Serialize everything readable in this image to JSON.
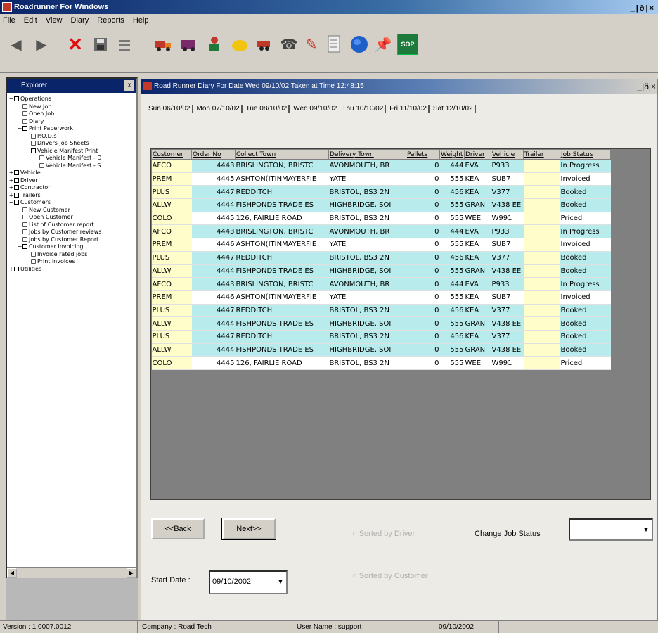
{
  "app": {
    "title": "Roadrunner For Windows",
    "window_buttons": "_|ð|×"
  },
  "menu": [
    "File",
    "Edit",
    "View",
    "Diary",
    "Reports",
    "Help"
  ],
  "toolbar": {
    "icons": [
      "back-arrow-icon",
      "forward-arrow-icon",
      "delete-icon",
      "save-icon",
      "tools-icon",
      "truck-icon",
      "vehicle-icon",
      "driver-icon",
      "helmet-icon",
      "trailer-icon",
      "phone-icon",
      "pencil-icon",
      "document-icon",
      "globe-icon",
      "pin-icon",
      "sop-icon"
    ],
    "sop_label": "SOP"
  },
  "explorer": {
    "title": "Explorer",
    "tree": [
      {
        "label": "Operations",
        "level": 0,
        "exp": "−",
        "folder": true
      },
      {
        "label": "New Job",
        "level": 1,
        "exp": "",
        "folder": false
      },
      {
        "label": "Open Job",
        "level": 1,
        "exp": "",
        "folder": false
      },
      {
        "label": "Diary",
        "level": 1,
        "exp": "",
        "folder": false
      },
      {
        "label": "Print Paperwork",
        "level": 1,
        "exp": "−",
        "folder": true
      },
      {
        "label": "P.O.D.s",
        "level": 2,
        "exp": "",
        "folder": false
      },
      {
        "label": "Drivers Job Sheets",
        "level": 2,
        "exp": "",
        "folder": false
      },
      {
        "label": "Vehicle Manifest Print",
        "level": 2,
        "exp": "−",
        "folder": true
      },
      {
        "label": "Vehicle Manifest - D",
        "level": 3,
        "exp": "",
        "folder": false
      },
      {
        "label": "Vehicle Manifest - S",
        "level": 3,
        "exp": "",
        "folder": false
      },
      {
        "label": "Vehicle",
        "level": 0,
        "exp": "+",
        "folder": true
      },
      {
        "label": "Driver",
        "level": 0,
        "exp": "+",
        "folder": true
      },
      {
        "label": "Contractor",
        "level": 0,
        "exp": "+",
        "folder": true
      },
      {
        "label": "Trailers",
        "level": 0,
        "exp": "+",
        "folder": true
      },
      {
        "label": "Customers",
        "level": 0,
        "exp": "−",
        "folder": true
      },
      {
        "label": "New Customer",
        "level": 1,
        "exp": "",
        "folder": false
      },
      {
        "label": "Open Customer",
        "level": 1,
        "exp": "",
        "folder": false
      },
      {
        "label": "List of Customer report",
        "level": 1,
        "exp": "",
        "folder": false
      },
      {
        "label": "Jobs by Customer reviews",
        "level": 1,
        "exp": "",
        "folder": false
      },
      {
        "label": "Jobs by Customer Report",
        "level": 1,
        "exp": "",
        "folder": false
      },
      {
        "label": "Customer Invoicing",
        "level": 1,
        "exp": "−",
        "folder": true
      },
      {
        "label": "Invoice rated jobs",
        "level": 2,
        "exp": "",
        "folder": false
      },
      {
        "label": "Print invoices",
        "level": 2,
        "exp": "",
        "folder": false
      },
      {
        "label": "Utilities",
        "level": 0,
        "exp": "+",
        "folder": true
      }
    ]
  },
  "diary": {
    "title": "Road Runner Diary For Date Wed 09/10/02 Taken at Time 12:48:15",
    "window_buttons": "_|ð|×",
    "days": [
      "Sun 06/10/02",
      "Mon 07/10/02",
      "Tue 08/10/02",
      "Wed 09/10/02",
      "Thu 10/10/02",
      "Fri 11/10/02",
      "Sat 12/10/02"
    ],
    "active_day": 3,
    "columns": [
      "Customer",
      "Order No",
      "Collect Town",
      "Delivery Town",
      "Pallets",
      "Weight",
      "Driver",
      "Vehicle",
      "Trailer",
      "Job Status"
    ],
    "rows": [
      {
        "tint": "c",
        "cells": [
          "AFCO",
          "4443",
          "BRISLINGTON, BRISTC",
          "AVONMOUTH, BR",
          "0",
          "444",
          "EVA",
          "P933",
          "",
          "In Progress"
        ]
      },
      {
        "tint": "w",
        "cells": [
          "PREM",
          "4445",
          "ASHTON(ITINMAYERFIE",
          "YATE",
          "0",
          "555",
          "KEA",
          "SUB7",
          "",
          "Invoiced"
        ]
      },
      {
        "tint": "c",
        "cells": [
          "PLUS",
          "4447",
          "REDDITCH",
          "BRISTOL, BS3 2N",
          "0",
          "456",
          "KEA",
          "V377",
          "",
          "Booked"
        ]
      },
      {
        "tint": "c",
        "cells": [
          "ALLW",
          "4444",
          "FISHPONDS TRADE ES",
          "HIGHBRIDGE, SOI",
          "0",
          "555",
          "GRAN",
          "V438 EE",
          "",
          "Booked"
        ]
      },
      {
        "tint": "w",
        "cells": [
          "COLO",
          "4445",
          "126, FAIRLIE ROAD",
          "BRISTOL, BS3 2N",
          "0",
          "555",
          "WEE",
          "W991",
          "",
          "Priced"
        ]
      },
      {
        "tint": "c",
        "cells": [
          "AFCO",
          "4443",
          "BRISLINGTON, BRISTC",
          "AVONMOUTH, BR",
          "0",
          "444",
          "EVA",
          "P933",
          "",
          "In Progress"
        ]
      },
      {
        "tint": "w",
        "cells": [
          "PREM",
          "4446",
          "ASHTON(ITINMAYERFIE",
          "YATE",
          "0",
          "555",
          "KEA",
          "SUB7",
          "",
          "Invoiced"
        ]
      },
      {
        "tint": "c",
        "cells": [
          "PLUS",
          "4447",
          "REDDITCH",
          "BRISTOL, BS3 2N",
          "0",
          "456",
          "KEA",
          "V377",
          "",
          "Booked"
        ]
      },
      {
        "tint": "c",
        "cells": [
          "ALLW",
          "4444",
          "FISHPONDS TRADE ES",
          "HIGHBRIDGE, SOI",
          "0",
          "555",
          "GRAN",
          "V438 EE",
          "",
          "Booked"
        ]
      },
      {
        "tint": "c",
        "cells": [
          "AFCO",
          "4443",
          "BRISLINGTON, BRISTC",
          "AVONMOUTH, BR",
          "0",
          "444",
          "EVA",
          "P933",
          "",
          "In Progress"
        ]
      },
      {
        "tint": "w",
        "cells": [
          "PREM",
          "4446",
          "ASHTON(ITINMAYERFIE",
          "YATE",
          "0",
          "555",
          "KEA",
          "SUB7",
          "",
          "Invoiced"
        ]
      },
      {
        "tint": "c",
        "cells": [
          "PLUS",
          "4447",
          "REDDITCH",
          "BRISTOL, BS3 2N",
          "0",
          "456",
          "KEA",
          "V377",
          "",
          "Booked"
        ]
      },
      {
        "tint": "c",
        "cells": [
          "ALLW",
          "4444",
          "FISHPONDS TRADE ES",
          "HIGHBRIDGE, SOI",
          "0",
          "555",
          "GRAN",
          "V438 EE",
          "",
          "Booked"
        ]
      },
      {
        "tint": "c",
        "cells": [
          "PLUS",
          "4447",
          "REDDITCH",
          "BRISTOL, BS3 2N",
          "0",
          "456",
          "KEA",
          "V377",
          "",
          "Booked"
        ]
      },
      {
        "tint": "c",
        "cells": [
          "ALLW",
          "4444",
          "FISHPONDS TRADE ES",
          "HIGHBRIDGE, SOI",
          "0",
          "555",
          "GRAN",
          "V438 EE",
          "",
          "Booked"
        ]
      },
      {
        "tint": "w",
        "cells": [
          "COLO",
          "4445",
          "126, FAIRLIE ROAD",
          "BRISTOL, BS3 2N",
          "0",
          "555",
          "WEE",
          "W991",
          "",
          "Priced"
        ]
      }
    ],
    "back_label": "<<Back",
    "next_label": "Next>>",
    "option1_label": "Sorted by Driver",
    "option2_label": "Sorted by Customer",
    "change_status_label": "Change Job Status",
    "change_status_value": "",
    "start_date_label": "Start Date :",
    "start_date_value": "09/10/2002"
  },
  "status": {
    "version": "Version : 1.0007.0012",
    "company": "Company : Road Tech",
    "user": "User Name : support",
    "date": "09/10/2002"
  },
  "colors": {
    "row_cyan": "#b8ecec",
    "row_white": "#ffffff",
    "yellow_col": "#fffecb",
    "title_blue": "#0a246a"
  }
}
